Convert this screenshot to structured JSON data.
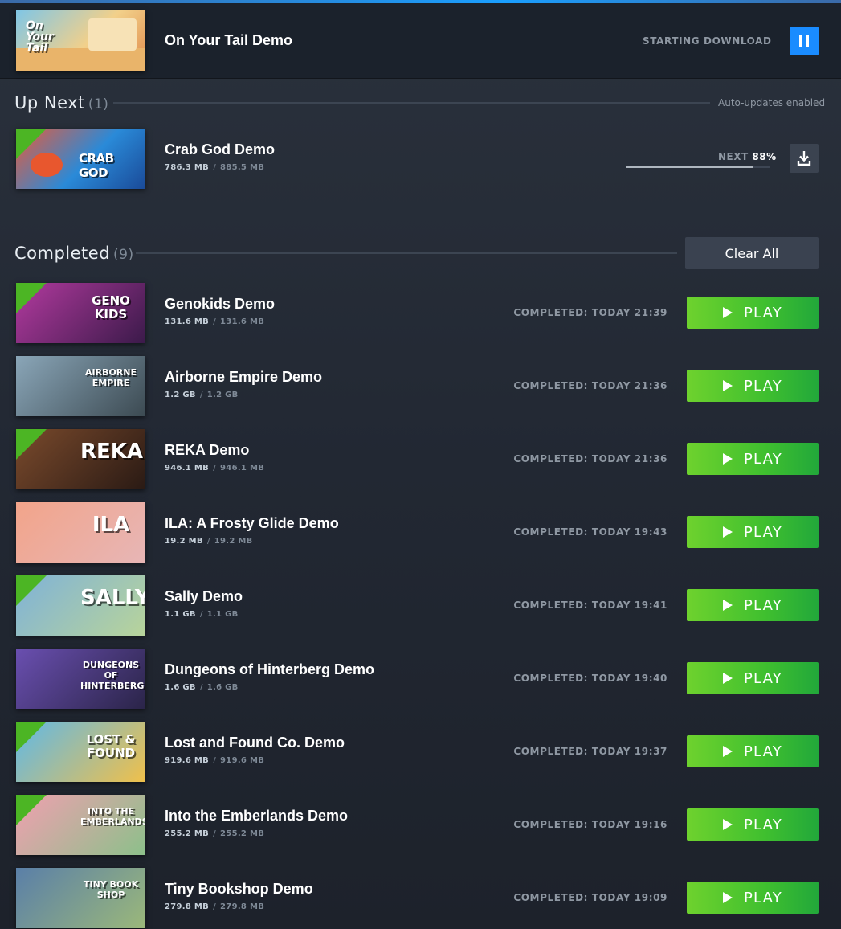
{
  "active": {
    "title": "On Your Tail Demo",
    "art_text": "On Your Tail",
    "status": "STARTING DOWNLOAD",
    "pause_icon": "pause-icon"
  },
  "up_next": {
    "title": "Up Next",
    "count": "(1)",
    "auto_updates": "Auto-updates enabled",
    "item": {
      "title": "Crab God Demo",
      "art_text": "CRAB GOD",
      "size_done": "786.3 MB",
      "size_total": "885.5 MB",
      "next_label": "NEXT",
      "next_pct": "88%",
      "progress": 0.88,
      "download_icon": "download-icon"
    }
  },
  "completed": {
    "title": "Completed",
    "count": "(9)",
    "clear_all": "Clear All",
    "play_label": "PLAY",
    "items": [
      {
        "title": "Genokids Demo",
        "art_text": "GENO KIDS",
        "size_done": "131.6 MB",
        "size_total": "131.6 MB",
        "status": "COMPLETED: TODAY 21:39",
        "demo": true,
        "c1": "#b23a9e",
        "c2": "#3b1a4a"
      },
      {
        "title": "Airborne Empire Demo",
        "art_text": "AIRBORNE EMPIRE",
        "size_done": "1.2 GB",
        "size_total": "1.2 GB",
        "status": "COMPLETED: TODAY 21:36",
        "demo": false,
        "c1": "#8aa6b8",
        "c2": "#3c4a52"
      },
      {
        "title": "REKA Demo",
        "art_text": "REKA",
        "size_done": "946.1 MB",
        "size_total": "946.1 MB",
        "status": "COMPLETED: TODAY 21:36",
        "demo": true,
        "c1": "#7a4a2c",
        "c2": "#2a1a14"
      },
      {
        "title": "ILA: A Frosty Glide Demo",
        "art_text": "ILA",
        "size_done": "19.2 MB",
        "size_total": "19.2 MB",
        "status": "COMPLETED: TODAY 19:43",
        "demo": false,
        "c1": "#f2a48a",
        "c2": "#e7b6b6"
      },
      {
        "title": "Sally Demo",
        "art_text": "SALLY",
        "size_done": "1.1 GB",
        "size_total": "1.1 GB",
        "status": "COMPLETED: TODAY 19:41",
        "demo": true,
        "c1": "#7fb2d8",
        "c2": "#b8d49a"
      },
      {
        "title": "Dungeons of Hinterberg Demo",
        "art_text": "DUNGEONS OF HINTERBERG",
        "size_done": "1.6 GB",
        "size_total": "1.6 GB",
        "status": "COMPLETED: TODAY 19:40",
        "demo": false,
        "c1": "#6a4fb0",
        "c2": "#2a2448"
      },
      {
        "title": "Lost and Found Co. Demo",
        "art_text": "LOST & FOUND",
        "size_done": "919.6 MB",
        "size_total": "919.6 MB",
        "status": "COMPLETED: TODAY 19:37",
        "demo": true,
        "c1": "#5fb8e8",
        "c2": "#f0c04a"
      },
      {
        "title": "Into the Emberlands Demo",
        "art_text": "INTO THE EMBERLANDS",
        "size_done": "255.2 MB",
        "size_total": "255.2 MB",
        "status": "COMPLETED: TODAY 19:16",
        "demo": true,
        "c1": "#f0a0b0",
        "c2": "#8cc08a"
      },
      {
        "title": "Tiny Bookshop Demo",
        "art_text": "TINY BOOK SHOP",
        "size_done": "279.8 MB",
        "size_total": "279.8 MB",
        "status": "COMPLETED: TODAY 19:09",
        "demo": false,
        "c1": "#5a7fa8",
        "c2": "#9bb87a"
      }
    ]
  }
}
